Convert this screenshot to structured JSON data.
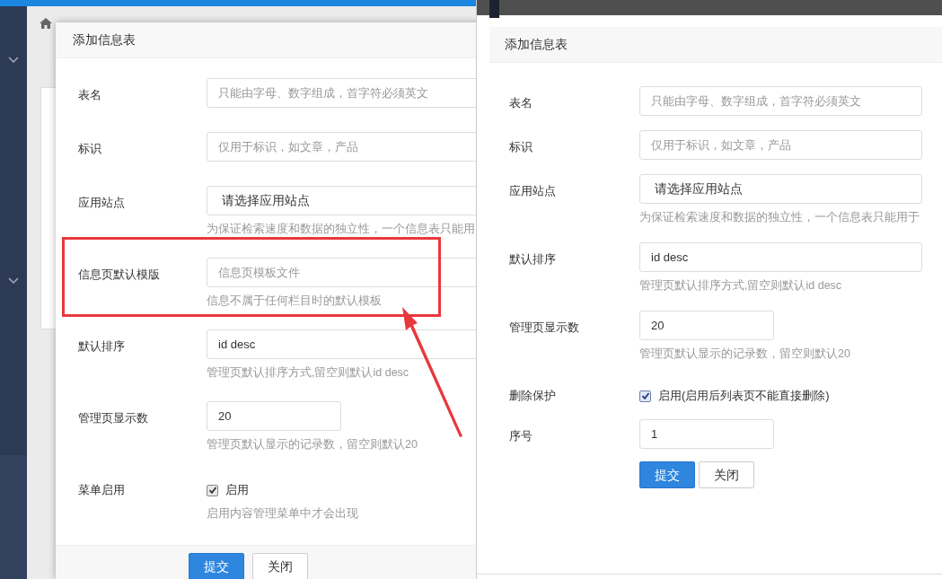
{
  "left_dialog": {
    "title": "添加信息表",
    "fields": [
      {
        "kind": "text",
        "label": "表名",
        "placeholder": "只能由字母、数字组成，首字符必须英文",
        "highlighted": false
      },
      {
        "kind": "text",
        "label": "标识",
        "placeholder": "仅用于标识，如文章，产品",
        "highlighted": false
      },
      {
        "kind": "select",
        "label": "应用站点",
        "value": "请选择应用站点",
        "help": "为保证检索速度和数据的独立性，一个信息表只能用",
        "highlighted": false
      },
      {
        "kind": "text",
        "label": "信息页默认模版",
        "placeholder": "信息页模板文件",
        "help": "信息不属于任何栏目时的默认模板",
        "highlighted": true
      },
      {
        "kind": "text",
        "label": "默认排序",
        "value": "id desc",
        "help": "管理页默认排序方式,留空则默认id desc",
        "highlighted": false
      },
      {
        "kind": "short",
        "label": "管理页显示数",
        "value": "20",
        "help": "管理页默认显示的记录数，留空则默认20",
        "highlighted": false
      },
      {
        "kind": "checkbox",
        "label": "菜单启用",
        "option": "启用",
        "checked": true,
        "help": "启用内容管理菜单中才会出现",
        "highlighted": false
      }
    ],
    "buttons": [
      {
        "label": "提交",
        "kind": "primary"
      },
      {
        "label": "关闭",
        "kind": "default"
      }
    ]
  },
  "right_dialog": {
    "title": "添加信息表",
    "fields": [
      {
        "kind": "text",
        "label": "表名",
        "placeholder": "只能由字母、数字组成，首字符必须英文"
      },
      {
        "kind": "text",
        "label": "标识",
        "placeholder": "仅用于标识，如文章，产品"
      },
      {
        "kind": "select",
        "label": "应用站点",
        "value": "请选择应用站点",
        "help": "为保证检索速度和数据的独立性，一个信息表只能用于"
      },
      {
        "kind": "text",
        "label": "默认排序",
        "value": "id desc",
        "help": "管理页默认排序方式,留空则默认id desc"
      },
      {
        "kind": "short",
        "label": "管理页显示数",
        "value": "20",
        "help": "管理页默认显示的记录数，留空则默认20"
      },
      {
        "kind": "checkbox",
        "label": "删除保护",
        "option": "启用(启用后列表页不能直接删除)",
        "checked": true
      },
      {
        "kind": "short",
        "label": "序号",
        "value": "1"
      }
    ],
    "buttons": [
      {
        "label": "提交",
        "kind": "primary"
      },
      {
        "label": "关闭",
        "kind": "default"
      }
    ]
  }
}
